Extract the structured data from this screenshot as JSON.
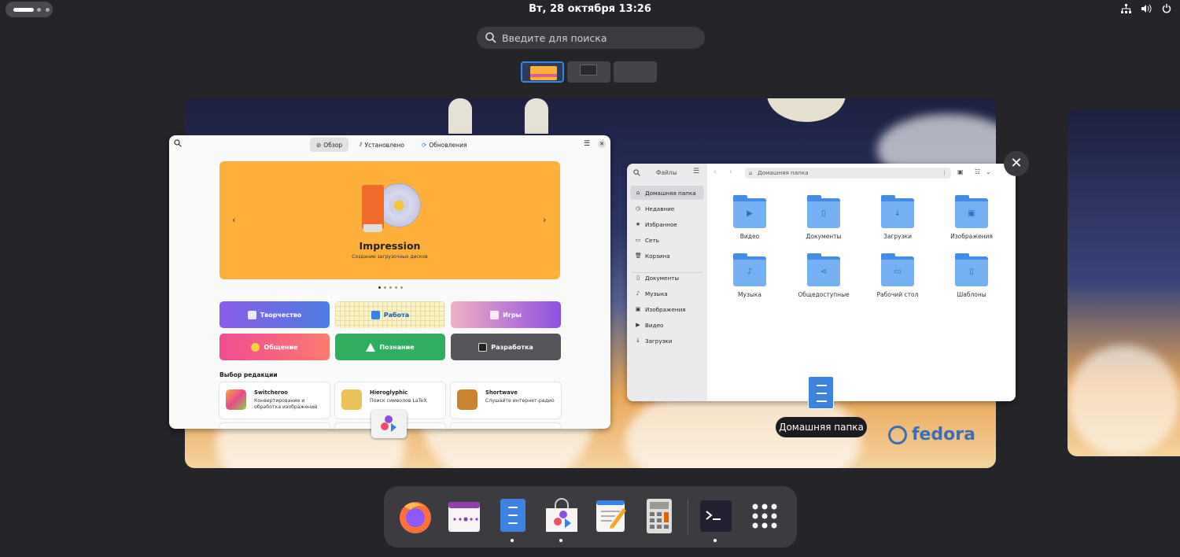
{
  "topbar": {
    "clock": "Вт, 28 октября  13:26",
    "tray_icons": [
      "network-icon",
      "volume-icon",
      "power-icon"
    ]
  },
  "search": {
    "placeholder": "Введите для поиска"
  },
  "software_window": {
    "tabs": [
      {
        "label": "Обзор",
        "active": true
      },
      {
        "label": "Установлено",
        "active": false
      },
      {
        "label": "Обновления",
        "active": false
      }
    ],
    "banner": {
      "title": "Impression",
      "subtitle": "Создание загрузочных дисков",
      "color": "#ffb03b"
    },
    "categories": [
      {
        "label": "Творчество",
        "color": "linear-gradient(90deg,#8a5ce8,#4d7de0)"
      },
      {
        "label": "Работа",
        "color": "#fbf3c9",
        "text_color": "#1b5cc2"
      },
      {
        "label": "Игры",
        "color": "linear-gradient(90deg,#f2b0c6,#8e4fe0)"
      },
      {
        "label": "Общение",
        "color": "linear-gradient(90deg,#f14c92,#fb7b6e)"
      },
      {
        "label": "Познание",
        "color": "#2fae5f"
      },
      {
        "label": "Разработка",
        "color": "#545459"
      }
    ],
    "editors_choice_title": "Выбор редакции",
    "picks": [
      {
        "name": "Switcheroo",
        "desc": "Конвертирование и обработка изображений",
        "icon_color": "#f4a83a"
      },
      {
        "name": "Hieroglyphic",
        "desc": "Поиск символов LaTeX",
        "icon_color": "#e9c25a"
      },
      {
        "name": "Shortwave",
        "desc": "Слушайте интернет-радио",
        "icon_color": "#c9822e"
      }
    ]
  },
  "files_window": {
    "title": "Файлы",
    "path": "Домашняя папка",
    "sidebar": [
      {
        "label": "Домашняя папка",
        "icon": "⌂",
        "active": true
      },
      {
        "label": "Недавние",
        "icon": "◷"
      },
      {
        "label": "Избранное",
        "icon": "★"
      },
      {
        "label": "Сеть",
        "icon": "▭"
      },
      {
        "label": "Корзина",
        "icon": "🗑"
      },
      {
        "label": "Документы",
        "icon": "▯"
      },
      {
        "label": "Музыка",
        "icon": "♪"
      },
      {
        "label": "Изображения",
        "icon": "▣"
      },
      {
        "label": "Видео",
        "icon": "▶"
      },
      {
        "label": "Загрузки",
        "icon": "↓"
      }
    ],
    "folders": [
      {
        "label": "Видео",
        "glyph": "▶"
      },
      {
        "label": "Документы",
        "glyph": "▯"
      },
      {
        "label": "Загрузки",
        "glyph": "↓"
      },
      {
        "label": "Изображения",
        "glyph": "▣"
      },
      {
        "label": "Музыка",
        "glyph": "♪"
      },
      {
        "label": "Общедоступные",
        "glyph": "⋖"
      },
      {
        "label": "Рабочий стол",
        "glyph": "▭"
      },
      {
        "label": "Шаблоны",
        "glyph": "▯"
      }
    ]
  },
  "tooltip": "Домашняя папка",
  "brand": "fedora",
  "dock": [
    {
      "name": "firefox",
      "running": false
    },
    {
      "name": "calendar",
      "running": false
    },
    {
      "name": "files",
      "running": true
    },
    {
      "name": "software",
      "running": true
    },
    {
      "name": "text-editor",
      "running": false
    },
    {
      "name": "calculator",
      "running": false
    },
    {
      "name": "terminal",
      "running": true
    },
    {
      "name": "app-grid",
      "running": false
    }
  ]
}
